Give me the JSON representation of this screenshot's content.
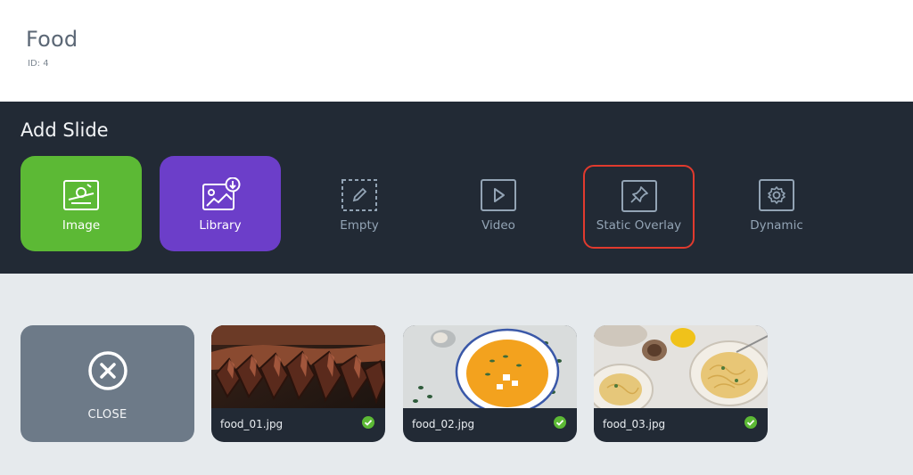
{
  "header": {
    "title": "Food",
    "id_label": "ID: 4"
  },
  "add_slide": {
    "title": "Add Slide",
    "options": [
      {
        "label": "Image",
        "icon": "image-icon",
        "style": "green"
      },
      {
        "label": "Library",
        "icon": "library-download-icon",
        "style": "purple"
      },
      {
        "label": "Empty",
        "icon": "empty-pencil-icon",
        "style": "plain"
      },
      {
        "label": "Video",
        "icon": "video-play-icon",
        "style": "plain"
      },
      {
        "label": "Static Overlay",
        "icon": "pin-icon",
        "style": "plain",
        "highlighted": true
      },
      {
        "label": "Dynamic",
        "icon": "gear-icon",
        "style": "plain"
      }
    ]
  },
  "library": {
    "close_label": "CLOSE",
    "items": [
      {
        "filename": "food_01.jpg",
        "selected": true
      },
      {
        "filename": "food_02.jpg",
        "selected": true
      },
      {
        "filename": "food_03.jpg",
        "selected": true
      }
    ]
  },
  "colors": {
    "green": "#5cb935",
    "purple": "#6c3ec9",
    "dark_panel": "#222a35",
    "highlight_border": "#e13a2e",
    "check": "#5cb935"
  }
}
